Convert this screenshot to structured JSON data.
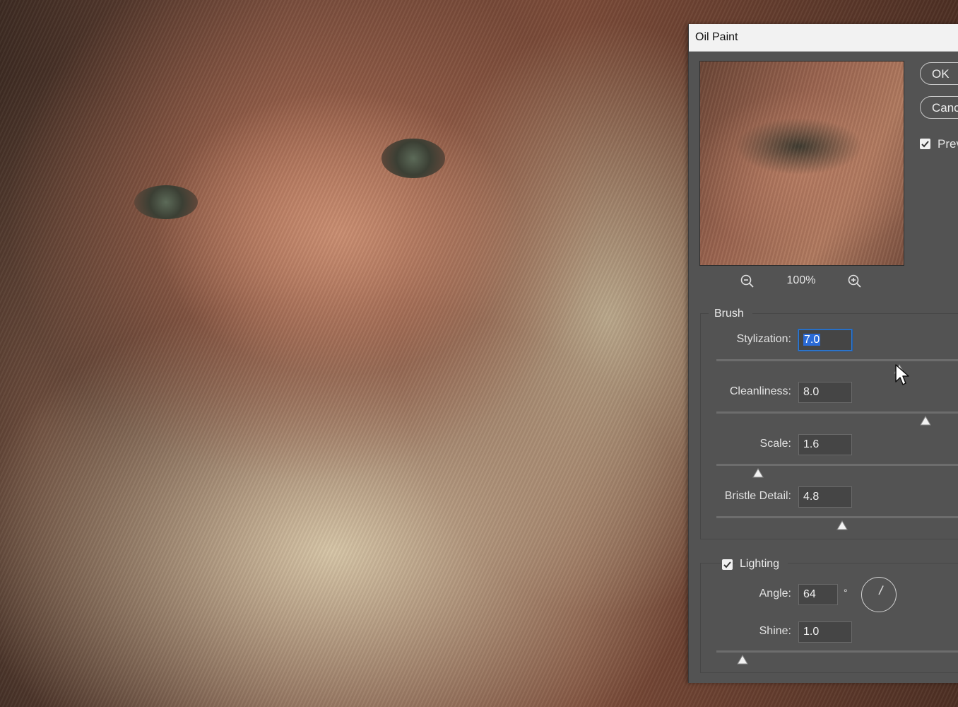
{
  "dialog": {
    "title": "Oil Paint",
    "ok_label": "OK",
    "cancel_label": "Canc",
    "preview_label": "Prev",
    "preview_checked": true,
    "zoom": "100%"
  },
  "brush": {
    "group_title": "Brush",
    "stylization": {
      "label": "Stylization:",
      "value": "7.0",
      "level": 0.7
    },
    "cleanliness": {
      "label": "Cleanliness:",
      "value": "8.0",
      "level": 0.8
    },
    "scale": {
      "label": "Scale:",
      "value": "1.6",
      "level": 0.16
    },
    "bristle_detail": {
      "label": "Bristle Detail:",
      "value": "4.8",
      "level": 0.48
    }
  },
  "lighting": {
    "group_title": "Lighting",
    "checked": true,
    "angle": {
      "label": "Angle:",
      "value": "64",
      "unit": "°",
      "degrees": 64
    },
    "shine": {
      "label": "Shine:",
      "value": "1.0",
      "level": 0.1
    }
  },
  "colors": {
    "dialog_bg": "#535353",
    "titlebar_bg": "#f2f2f2",
    "focus_ring": "#2f7bd6",
    "selection": "#2a6ad6"
  },
  "icons": {
    "zoom_out": "zoom-out-magnifier-icon",
    "zoom_in": "zoom-in-magnifier-icon",
    "checkbox": "checkmark-icon",
    "thumb": "triangle-slider-thumb-icon",
    "cursor": "mouse-pointer-icon"
  }
}
